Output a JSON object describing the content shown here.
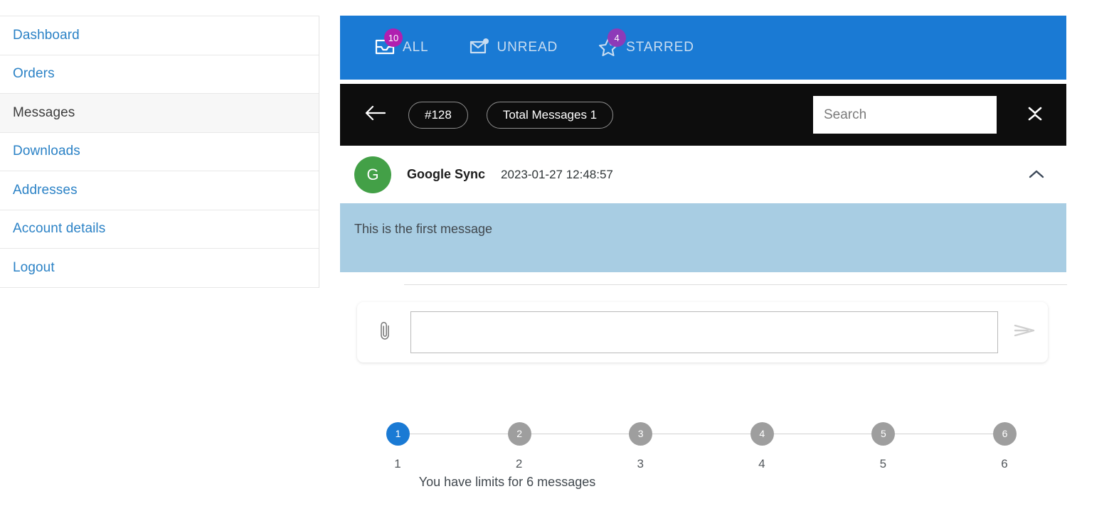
{
  "sidebar": {
    "items": [
      {
        "label": "Dashboard",
        "name": "dashboard",
        "active": false
      },
      {
        "label": "Orders",
        "name": "orders",
        "active": false
      },
      {
        "label": "Messages",
        "name": "messages",
        "active": true
      },
      {
        "label": "Downloads",
        "name": "downloads",
        "active": false
      },
      {
        "label": "Addresses",
        "name": "addresses",
        "active": false
      },
      {
        "label": "Account details",
        "name": "account-details",
        "active": false
      },
      {
        "label": "Logout",
        "name": "logout",
        "active": false
      }
    ]
  },
  "tabs": {
    "background": "#1a7ad4",
    "items": [
      {
        "label": "ALL",
        "icon": "inbox-icon",
        "badge": "10",
        "badge_color": "#b01fb0"
      },
      {
        "label": "UNREAD",
        "icon": "envelope-unread-icon",
        "badge": "",
        "badge_color": ""
      },
      {
        "label": "STARRED",
        "icon": "star-icon",
        "badge": "4",
        "badge_color": "#8d3bb8"
      }
    ]
  },
  "toolbar": {
    "background": "#0d0d0d",
    "back_icon": "arrow-left-icon",
    "ticket_id": "#128",
    "total_messages": "Total Messages 1",
    "search_value": "",
    "search_placeholder": "Search",
    "collapse_icon": "collapse-chevrons-icon"
  },
  "message": {
    "avatar_initial": "G",
    "avatar_color": "#43a047",
    "sender": "Google Sync",
    "timestamp": "2023-01-27 12:48:57",
    "collapse_icon": "chevron-up-icon",
    "body": "This is the first message",
    "body_background": "#a8cde3"
  },
  "compose": {
    "attach_icon": "paperclip-icon",
    "input_value": "",
    "input_placeholder": "",
    "send_icon": "send-icon"
  },
  "stepper": {
    "active_color": "#1a7ad4",
    "inactive_color": "#9e9e9e",
    "steps": [
      {
        "num": "1",
        "label": "1",
        "active": true
      },
      {
        "num": "2",
        "label": "2",
        "active": false
      },
      {
        "num": "3",
        "label": "3",
        "active": false
      },
      {
        "num": "4",
        "label": "4",
        "active": false
      },
      {
        "num": "5",
        "label": "5",
        "active": false
      },
      {
        "num": "6",
        "label": "6",
        "active": false
      }
    ],
    "limit_text": "You have limits for 6 messages"
  }
}
